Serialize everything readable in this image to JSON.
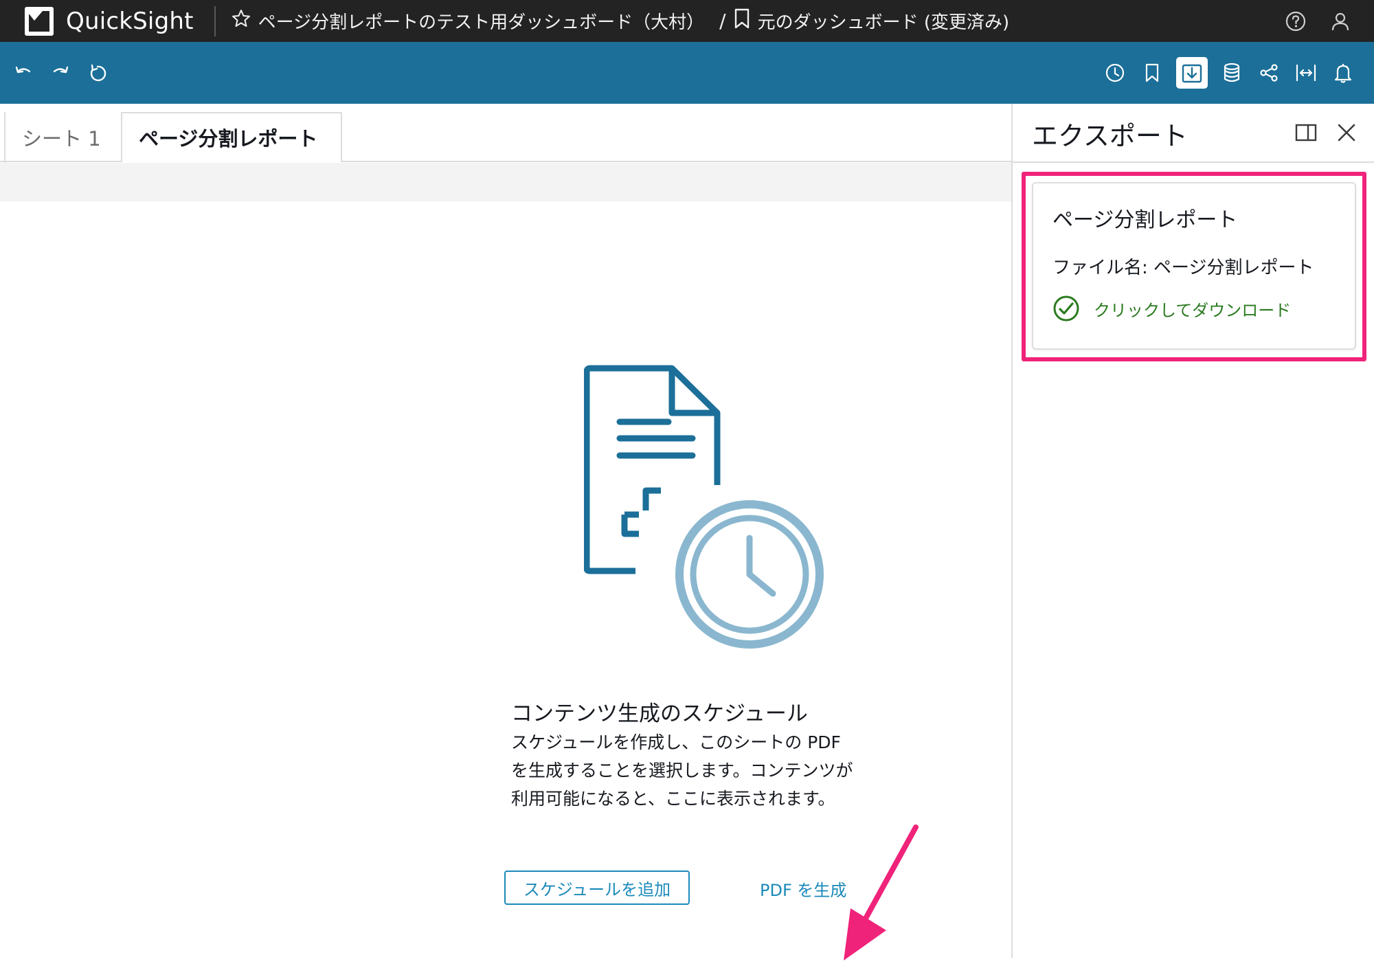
{
  "app": {
    "brand": "QuickSight",
    "breadcrumb_dashboard": "ページ分割レポートのテスト用ダッシュボード（大村）",
    "breadcrumb_separator": "/",
    "breadcrumb_bookmark": "元のダッシュボード (変更済み)"
  },
  "header_icons": [
    "help-icon",
    "user-icon"
  ],
  "toolbar": {
    "left_icons": [
      "undo-icon",
      "redo-icon",
      "reset-icon"
    ],
    "right_icons": [
      "schedule-icon",
      "bookmark-icon",
      "export-icon",
      "dataset-icon",
      "share-icon",
      "fit-width-icon",
      "alert-icon"
    ],
    "active_icon": "export-icon"
  },
  "tabs": [
    {
      "label": "シート 1",
      "active": false
    },
    {
      "label": "ページ分割レポート",
      "active": true
    }
  ],
  "empty_state": {
    "title": "コンテンツ生成のスケジュール",
    "description": "スケジュールを作成し、このシートの PDF を生成することを選択します。コンテンツが利用可能になると、ここに表示されます。",
    "add_schedule_label": "スケジュールを追加",
    "generate_pdf_label": "PDF を生成"
  },
  "export_panel": {
    "title": "エクスポート",
    "item_title": "ページ分割レポート",
    "file_name": "ファイル名: ページ分割レポート",
    "download_label": "クリックしてダウンロード"
  },
  "colors": {
    "topbar": "#232323",
    "toolbar": "#1b6f99",
    "link": "#1b8ab9",
    "success": "#2a7a1f",
    "highlight": "#f0237a"
  }
}
